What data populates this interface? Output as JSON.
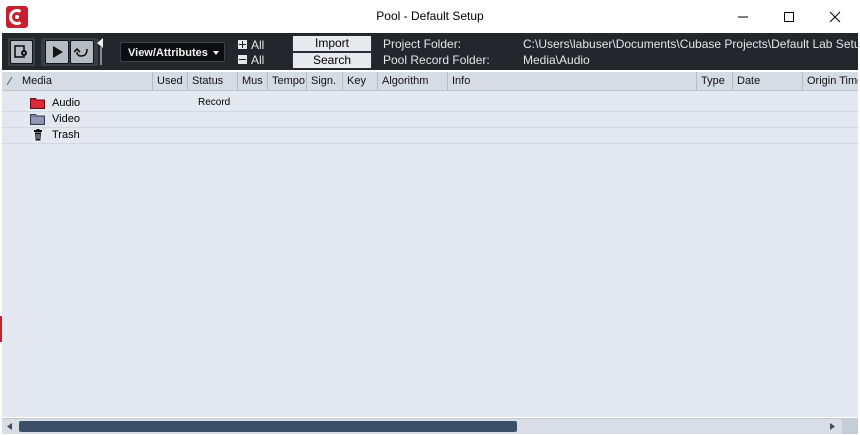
{
  "window": {
    "title": "Pool - Default Setup",
    "accent_color": "#c8202f",
    "icons": [
      "cubase-logo-icon",
      "minimize-icon",
      "maximize-icon",
      "close-icon"
    ]
  },
  "toolbar": {
    "icons": [
      "inspector-icon",
      "play-icon",
      "loop-icon",
      "pin-icon"
    ],
    "view_attributes_label": "View/Attributes",
    "expand_all_label": "All",
    "collapse_all_label": "All",
    "import_label": "Import",
    "search_label": "Search",
    "project_folder_label": "Project Folder:",
    "project_folder_value": "C:\\Users\\labuser\\Documents\\Cubase Projects\\Default Lab Setup",
    "pool_record_folder_label": "Pool Record Folder:",
    "pool_record_folder_value": "Media\\Audio"
  },
  "columns": [
    "Media",
    "Used",
    "Status",
    "Mus",
    "Tempo",
    "Sign.",
    "Key",
    "Algorithm",
    "Info",
    "Type",
    "Date",
    "Origin Time"
  ],
  "folders": [
    {
      "label": "Audio",
      "status": "Record",
      "icon": "audio-folder-icon"
    },
    {
      "label": "Video",
      "status": "",
      "icon": "video-folder-icon"
    },
    {
      "label": "Trash",
      "status": "",
      "icon": "trash-icon"
    }
  ]
}
